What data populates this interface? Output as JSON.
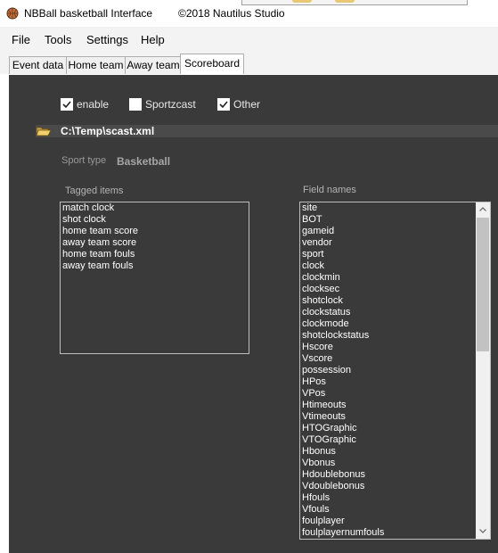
{
  "window": {
    "title": "NBBall basketball Interface",
    "copyright": "©2018 Nautilus Studio"
  },
  "menu": {
    "items": [
      "File",
      "Tools",
      "Settings",
      "Help"
    ]
  },
  "tabs": [
    {
      "label": "Event data",
      "active": false
    },
    {
      "label": "Home team",
      "active": false
    },
    {
      "label": "Away team",
      "active": false
    },
    {
      "label": "Scoreboard",
      "active": true
    }
  ],
  "scoreboard": {
    "options": [
      {
        "label": "enable",
        "checked": true
      },
      {
        "label": "Sportzcast",
        "checked": false
      },
      {
        "label": "Other",
        "checked": true
      }
    ],
    "file_path": "C:\\Temp\\scast.xml",
    "sport_type_label": "Sport type",
    "sport_type_value": "Basketball",
    "tagged_items_label": "Tagged items",
    "tagged_items": [
      "match clock",
      "shot clock",
      "home team score",
      "away team score",
      "home team fouls",
      "away team fouls"
    ],
    "field_names_label": "Field names",
    "field_names": [
      "site",
      "BOT",
      "gameid",
      "vendor",
      "sport",
      "clock",
      "clockmin",
      "clocksec",
      "shotclock",
      "clockstatus",
      "clockmode",
      "shotclockstatus",
      "Hscore",
      "Vscore",
      "possession",
      "HPos",
      "VPos",
      "Htimeouts",
      "Vtimeouts",
      "HTOGraphic",
      "VTOGraphic",
      "Hbonus",
      "Vbonus",
      "Hdoublebonus",
      "Vdoublebonus",
      "Hfouls",
      "Vfouls",
      "foulplayer",
      "foulplayernumfouls"
    ]
  },
  "colors": {
    "panel_bg": "#3a3a3a",
    "chrome_bg": "#f3f3f3",
    "list_text": "#ffffff"
  },
  "icons": {
    "app": "basketball-icon",
    "file": "folder-open-icon",
    "check": "checkmark-icon",
    "scroll_up": "arrow-up-icon",
    "scroll_down": "arrow-down-icon"
  }
}
